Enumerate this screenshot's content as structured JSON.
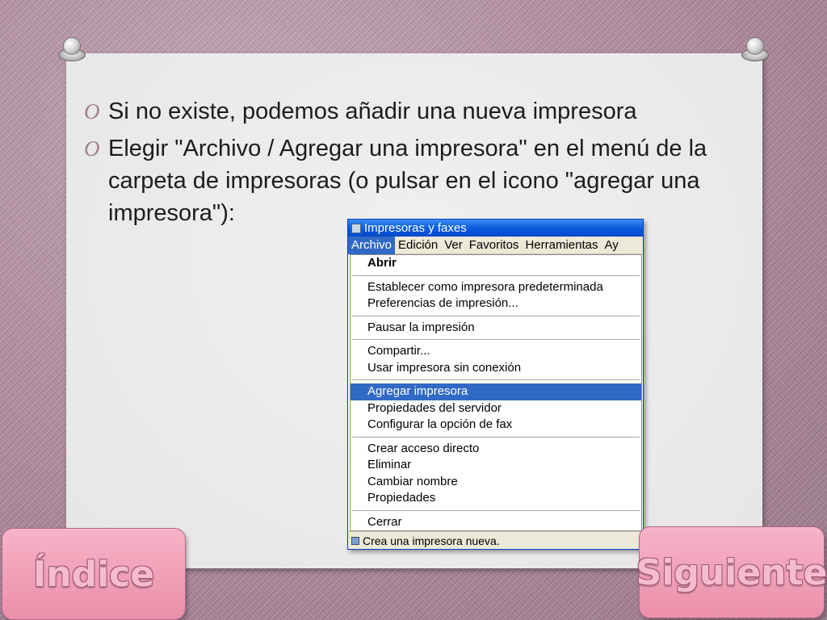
{
  "slide": {
    "bullets": [
      "Si no existe, podemos añadir una nueva impresora",
      "Elegir \"Archivo / Agregar una impresora\" en el menú de la carpeta de impresoras (o pulsar en el icono \"agregar una impresora\"):"
    ],
    "bullet_marker": "O"
  },
  "window": {
    "title": "Impresoras y faxes",
    "menubar": [
      "Archivo",
      "Edición",
      "Ver",
      "Favoritos",
      "Herramientas",
      "Ay"
    ],
    "menu_groups": [
      [
        "Abrir"
      ],
      [
        "Establecer como impresora predeterminada",
        "Preferencias de impresión..."
      ],
      [
        "Pausar la impresión"
      ],
      [
        "Compartir...",
        "Usar impresora sin conexión"
      ],
      [
        "Agregar impresora",
        "Propiedades del servidor",
        "Configurar la opción de fax"
      ],
      [
        "Crear acceso directo",
        "Eliminar",
        "Cambiar nombre",
        "Propiedades"
      ],
      [
        "Cerrar"
      ]
    ],
    "highlighted_item": "Agregar impresora",
    "status_text": "Crea una impresora nueva."
  },
  "nav": {
    "index_label": "Índice",
    "next_label": "Siguiente"
  },
  "colors": {
    "background": "#b896a6",
    "nav_button": "#ef9db6",
    "menu_highlight": "#316ac5",
    "titlebar": "#0a5ce0"
  }
}
